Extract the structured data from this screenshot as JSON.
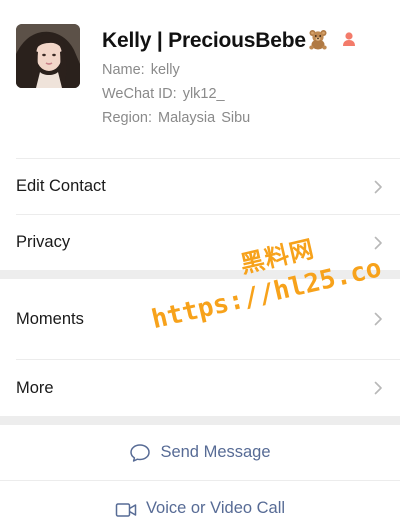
{
  "profile": {
    "display_name": "Kelly | PreciousBebe",
    "name_label": "Name:",
    "name_value": "kelly",
    "wechat_id_label": "WeChat ID:",
    "wechat_id_value": "ylk12_",
    "region_label": "Region:",
    "region_country": "Malaysia",
    "region_city": "Sibu",
    "name_emoji_icon": "teddy-bear-icon",
    "gender_icon": "female-gender-icon"
  },
  "rows": {
    "edit_contact": "Edit Contact",
    "privacy": "Privacy",
    "moments": "Moments",
    "more": "More"
  },
  "actions": {
    "send_message": "Send Message",
    "voice_video_call": "Voice or Video Call"
  },
  "watermark": {
    "chinese_text": "黑料网",
    "url_text": "https://hl25.co"
  },
  "colors": {
    "link_blue": "#576b95",
    "separator_gray": "#ededed",
    "watermark_orange": "#f7a21b",
    "secondary_text": "#8a8a8a"
  }
}
